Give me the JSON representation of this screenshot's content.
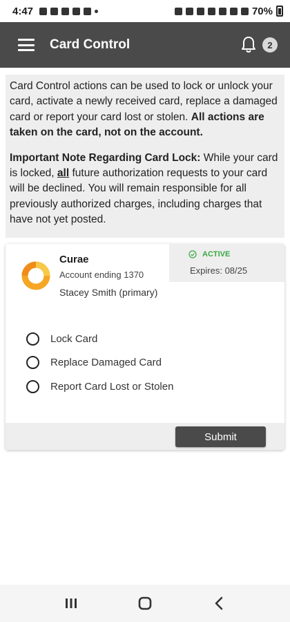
{
  "status_bar": {
    "time": "4:47",
    "battery": "70%"
  },
  "app_bar": {
    "title": "Card Control",
    "notification_count": "2"
  },
  "info": {
    "para1_text": "Card Control actions can be used to lock or unlock your card, activate a newly received card, replace a damaged card or report your card lost or stolen. ",
    "para1_bold": "All actions are taken on the card, not on the account.",
    "para2_bold": "Important Note Regarding Card Lock:",
    "para2_text_a": " While your card is locked, ",
    "para2_underline": "all",
    "para2_text_b": " future authorization requests to your card will be declined. You will remain responsible for all previously authorized charges, including charges that have not yet posted."
  },
  "card": {
    "name": "Curae",
    "account": "Account ending 1370",
    "holder": "Stacey Smith (primary)",
    "status": "ACTIVE",
    "expires": "Expires: 08/25",
    "status_color": "#3aa843",
    "logo_color": "#f5a623"
  },
  "options": [
    {
      "label": "Lock Card"
    },
    {
      "label": "Replace Damaged Card"
    },
    {
      "label": "Report Card Lost or Stolen"
    }
  ],
  "submit_label": "Submit",
  "colors": {
    "app_bar": "#4a4a4a",
    "panel_bg": "#eeeeee"
  }
}
